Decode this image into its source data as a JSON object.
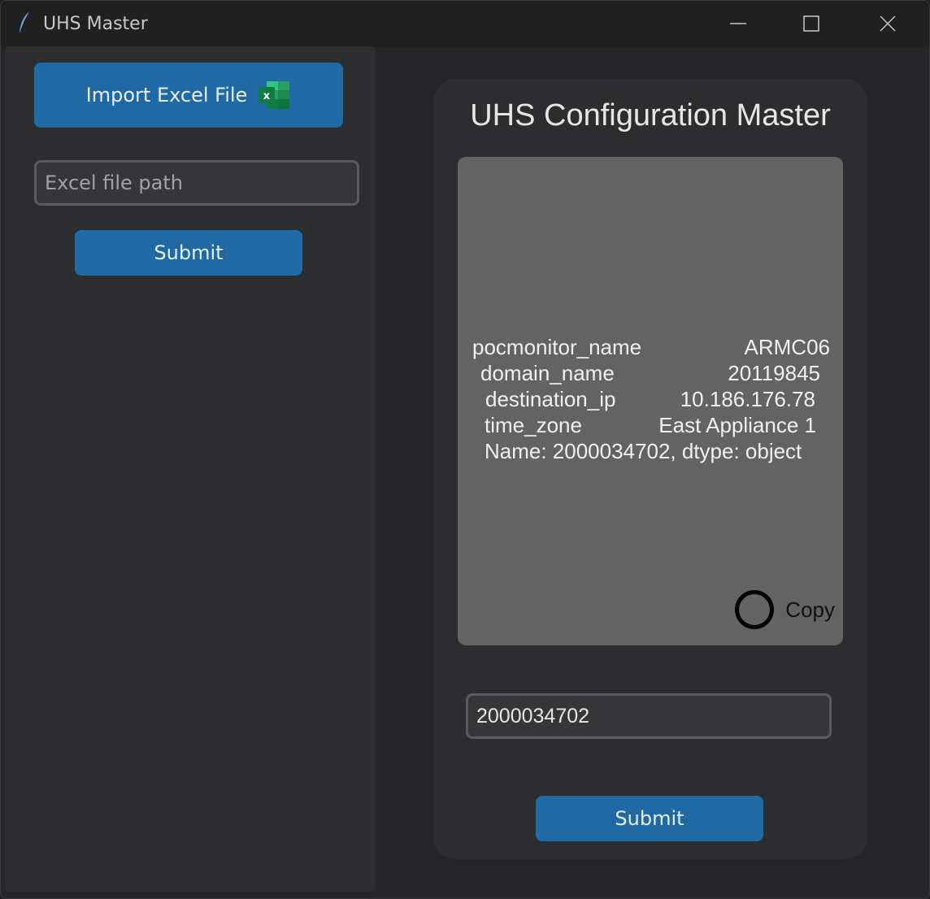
{
  "window": {
    "title": "UHS Master"
  },
  "sidebar": {
    "import_label": "Import Excel File",
    "path_placeholder": "Excel file path",
    "path_value": "",
    "submit_label": "Submit"
  },
  "main": {
    "title": "UHS Configuration Master",
    "output": {
      "rows": [
        {
          "key": "pocmonitor_name",
          "value": "ARMC06"
        },
        {
          "key": "domain_name",
          "value": "20119845"
        },
        {
          "key": "destination_ip",
          "value": "10.186.176.78"
        },
        {
          "key": "time_zone",
          "value": "East Appliance 1"
        }
      ],
      "footer": "Name: 2000034702, dtype: object"
    },
    "copy_label": "Copy",
    "id_input_value": "2000034702",
    "submit_label": "Submit"
  },
  "colors": {
    "accent": "#1f6aa5",
    "background": "#242526",
    "panel": "#2b2d2f",
    "output_box": "#636363"
  }
}
